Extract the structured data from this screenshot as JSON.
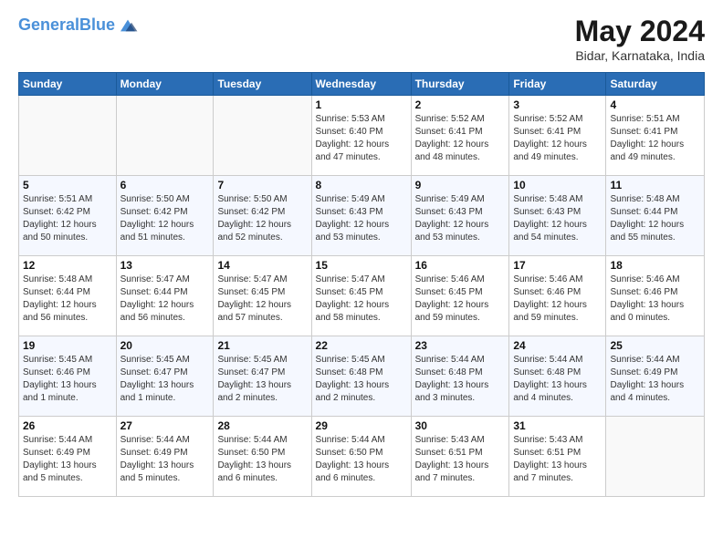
{
  "header": {
    "logo_line1": "General",
    "logo_line2": "Blue",
    "main_title": "May 2024",
    "subtitle": "Bidar, Karnataka, India"
  },
  "days_of_week": [
    "Sunday",
    "Monday",
    "Tuesday",
    "Wednesday",
    "Thursday",
    "Friday",
    "Saturday"
  ],
  "weeks": [
    [
      {
        "day": "",
        "info": ""
      },
      {
        "day": "",
        "info": ""
      },
      {
        "day": "",
        "info": ""
      },
      {
        "day": "1",
        "info": "Sunrise: 5:53 AM\nSunset: 6:40 PM\nDaylight: 12 hours\nand 47 minutes."
      },
      {
        "day": "2",
        "info": "Sunrise: 5:52 AM\nSunset: 6:41 PM\nDaylight: 12 hours\nand 48 minutes."
      },
      {
        "day": "3",
        "info": "Sunrise: 5:52 AM\nSunset: 6:41 PM\nDaylight: 12 hours\nand 49 minutes."
      },
      {
        "day": "4",
        "info": "Sunrise: 5:51 AM\nSunset: 6:41 PM\nDaylight: 12 hours\nand 49 minutes."
      }
    ],
    [
      {
        "day": "5",
        "info": "Sunrise: 5:51 AM\nSunset: 6:42 PM\nDaylight: 12 hours\nand 50 minutes."
      },
      {
        "day": "6",
        "info": "Sunrise: 5:50 AM\nSunset: 6:42 PM\nDaylight: 12 hours\nand 51 minutes."
      },
      {
        "day": "7",
        "info": "Sunrise: 5:50 AM\nSunset: 6:42 PM\nDaylight: 12 hours\nand 52 minutes."
      },
      {
        "day": "8",
        "info": "Sunrise: 5:49 AM\nSunset: 6:43 PM\nDaylight: 12 hours\nand 53 minutes."
      },
      {
        "day": "9",
        "info": "Sunrise: 5:49 AM\nSunset: 6:43 PM\nDaylight: 12 hours\nand 53 minutes."
      },
      {
        "day": "10",
        "info": "Sunrise: 5:48 AM\nSunset: 6:43 PM\nDaylight: 12 hours\nand 54 minutes."
      },
      {
        "day": "11",
        "info": "Sunrise: 5:48 AM\nSunset: 6:44 PM\nDaylight: 12 hours\nand 55 minutes."
      }
    ],
    [
      {
        "day": "12",
        "info": "Sunrise: 5:48 AM\nSunset: 6:44 PM\nDaylight: 12 hours\nand 56 minutes."
      },
      {
        "day": "13",
        "info": "Sunrise: 5:47 AM\nSunset: 6:44 PM\nDaylight: 12 hours\nand 56 minutes."
      },
      {
        "day": "14",
        "info": "Sunrise: 5:47 AM\nSunset: 6:45 PM\nDaylight: 12 hours\nand 57 minutes."
      },
      {
        "day": "15",
        "info": "Sunrise: 5:47 AM\nSunset: 6:45 PM\nDaylight: 12 hours\nand 58 minutes."
      },
      {
        "day": "16",
        "info": "Sunrise: 5:46 AM\nSunset: 6:45 PM\nDaylight: 12 hours\nand 59 minutes."
      },
      {
        "day": "17",
        "info": "Sunrise: 5:46 AM\nSunset: 6:46 PM\nDaylight: 12 hours\nand 59 minutes."
      },
      {
        "day": "18",
        "info": "Sunrise: 5:46 AM\nSunset: 6:46 PM\nDaylight: 13 hours\nand 0 minutes."
      }
    ],
    [
      {
        "day": "19",
        "info": "Sunrise: 5:45 AM\nSunset: 6:46 PM\nDaylight: 13 hours\nand 1 minute."
      },
      {
        "day": "20",
        "info": "Sunrise: 5:45 AM\nSunset: 6:47 PM\nDaylight: 13 hours\nand 1 minute."
      },
      {
        "day": "21",
        "info": "Sunrise: 5:45 AM\nSunset: 6:47 PM\nDaylight: 13 hours\nand 2 minutes."
      },
      {
        "day": "22",
        "info": "Sunrise: 5:45 AM\nSunset: 6:48 PM\nDaylight: 13 hours\nand 2 minutes."
      },
      {
        "day": "23",
        "info": "Sunrise: 5:44 AM\nSunset: 6:48 PM\nDaylight: 13 hours\nand 3 minutes."
      },
      {
        "day": "24",
        "info": "Sunrise: 5:44 AM\nSunset: 6:48 PM\nDaylight: 13 hours\nand 4 minutes."
      },
      {
        "day": "25",
        "info": "Sunrise: 5:44 AM\nSunset: 6:49 PM\nDaylight: 13 hours\nand 4 minutes."
      }
    ],
    [
      {
        "day": "26",
        "info": "Sunrise: 5:44 AM\nSunset: 6:49 PM\nDaylight: 13 hours\nand 5 minutes."
      },
      {
        "day": "27",
        "info": "Sunrise: 5:44 AM\nSunset: 6:49 PM\nDaylight: 13 hours\nand 5 minutes."
      },
      {
        "day": "28",
        "info": "Sunrise: 5:44 AM\nSunset: 6:50 PM\nDaylight: 13 hours\nand 6 minutes."
      },
      {
        "day": "29",
        "info": "Sunrise: 5:44 AM\nSunset: 6:50 PM\nDaylight: 13 hours\nand 6 minutes."
      },
      {
        "day": "30",
        "info": "Sunrise: 5:43 AM\nSunset: 6:51 PM\nDaylight: 13 hours\nand 7 minutes."
      },
      {
        "day": "31",
        "info": "Sunrise: 5:43 AM\nSunset: 6:51 PM\nDaylight: 13 hours\nand 7 minutes."
      },
      {
        "day": "",
        "info": ""
      }
    ]
  ]
}
